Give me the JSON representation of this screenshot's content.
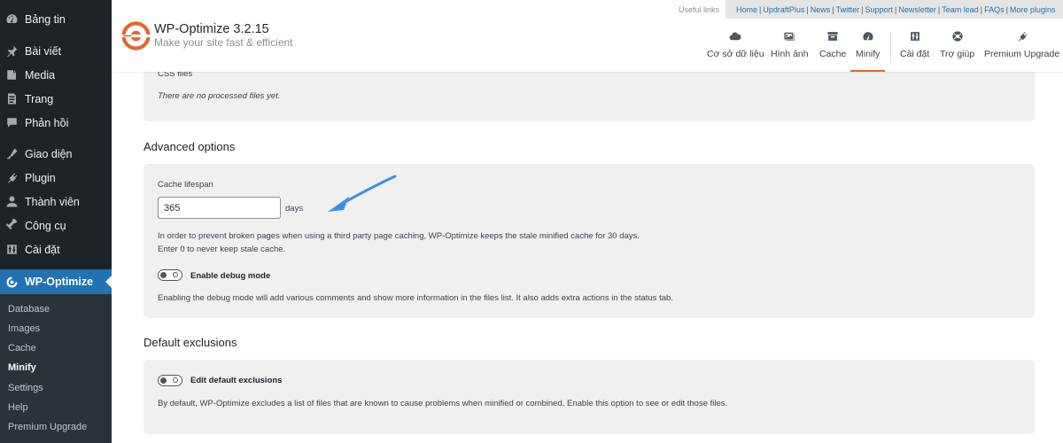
{
  "sidebar": {
    "items": [
      {
        "label": "Bảng tin",
        "icon": "dashboard-icon"
      },
      {
        "label": "Bài viết",
        "icon": "pin-icon"
      },
      {
        "label": "Media",
        "icon": "media-icon"
      },
      {
        "label": "Trang",
        "icon": "page-icon"
      },
      {
        "label": "Phản hồi",
        "icon": "comment-icon"
      },
      {
        "label": "Giao diện",
        "icon": "appearance-icon"
      },
      {
        "label": "Plugin",
        "icon": "plugin-icon"
      },
      {
        "label": "Thành viên",
        "icon": "users-icon"
      },
      {
        "label": "Công cụ",
        "icon": "tools-icon"
      },
      {
        "label": "Cài đặt",
        "icon": "settings-icon"
      },
      {
        "label": "WP-Optimize",
        "icon": "wp-optimize-icon"
      }
    ],
    "submenu": [
      "Database",
      "Images",
      "Cache",
      "Minify",
      "Settings",
      "Help",
      "Premium Upgrade"
    ]
  },
  "header": {
    "title": "WP-Optimize 3.2.15",
    "tagline": "Make your site fast & efficient",
    "useful_links_label": "Useful links",
    "links": [
      "Home",
      "UpdraftPlus",
      "News",
      "Twitter",
      "Support",
      "Newsletter",
      "Team lead",
      "FAQs",
      "More plugins"
    ],
    "tabs": [
      {
        "label": "Cơ sở dữ liệu",
        "icon": "cloud-icon"
      },
      {
        "label": "Hình ảnh",
        "icon": "images-icon"
      },
      {
        "label": "Cache",
        "icon": "archive-icon"
      },
      {
        "label": "Minify",
        "icon": "dashboard-gauge-icon"
      },
      {
        "label": "Cài đặt",
        "icon": "sliders-icon"
      },
      {
        "label": "Trợ giúp",
        "icon": "lifebuoy-icon"
      },
      {
        "label": "Premium Upgrade",
        "icon": "plug-icon"
      }
    ],
    "active_tab": "Minify"
  },
  "css_files": {
    "label": "CSS files",
    "empty_text": "There are no processed files yet."
  },
  "advanced": {
    "heading": "Advanced options",
    "lifespan_label": "Cache lifespan",
    "lifespan_value": "365",
    "lifespan_unit": "days",
    "help_line1": "In order to prevent broken pages when using a third party page caching, WP-Optimize keeps the stale minified cache for 30 days.",
    "help_line2": "Enter 0 to never keep stale cache.",
    "debug_label": "Enable debug mode",
    "debug_help": "Enabling the debug mode will add various comments and show more information in the files list. It also adds extra actions in the status tab."
  },
  "exclusions": {
    "heading": "Default exclusions",
    "toggle_label": "Edit default exclusions",
    "help": "By default, WP-Optimize excludes a list of files that are known to cause problems when minified or combined. Enable this option to see or edit those files."
  },
  "colors": {
    "sidebar_bg": "#1d2327",
    "accent_blue": "#2271b1",
    "brand_orange": "#e0662e",
    "arrow_blue": "#3b8fe8"
  }
}
